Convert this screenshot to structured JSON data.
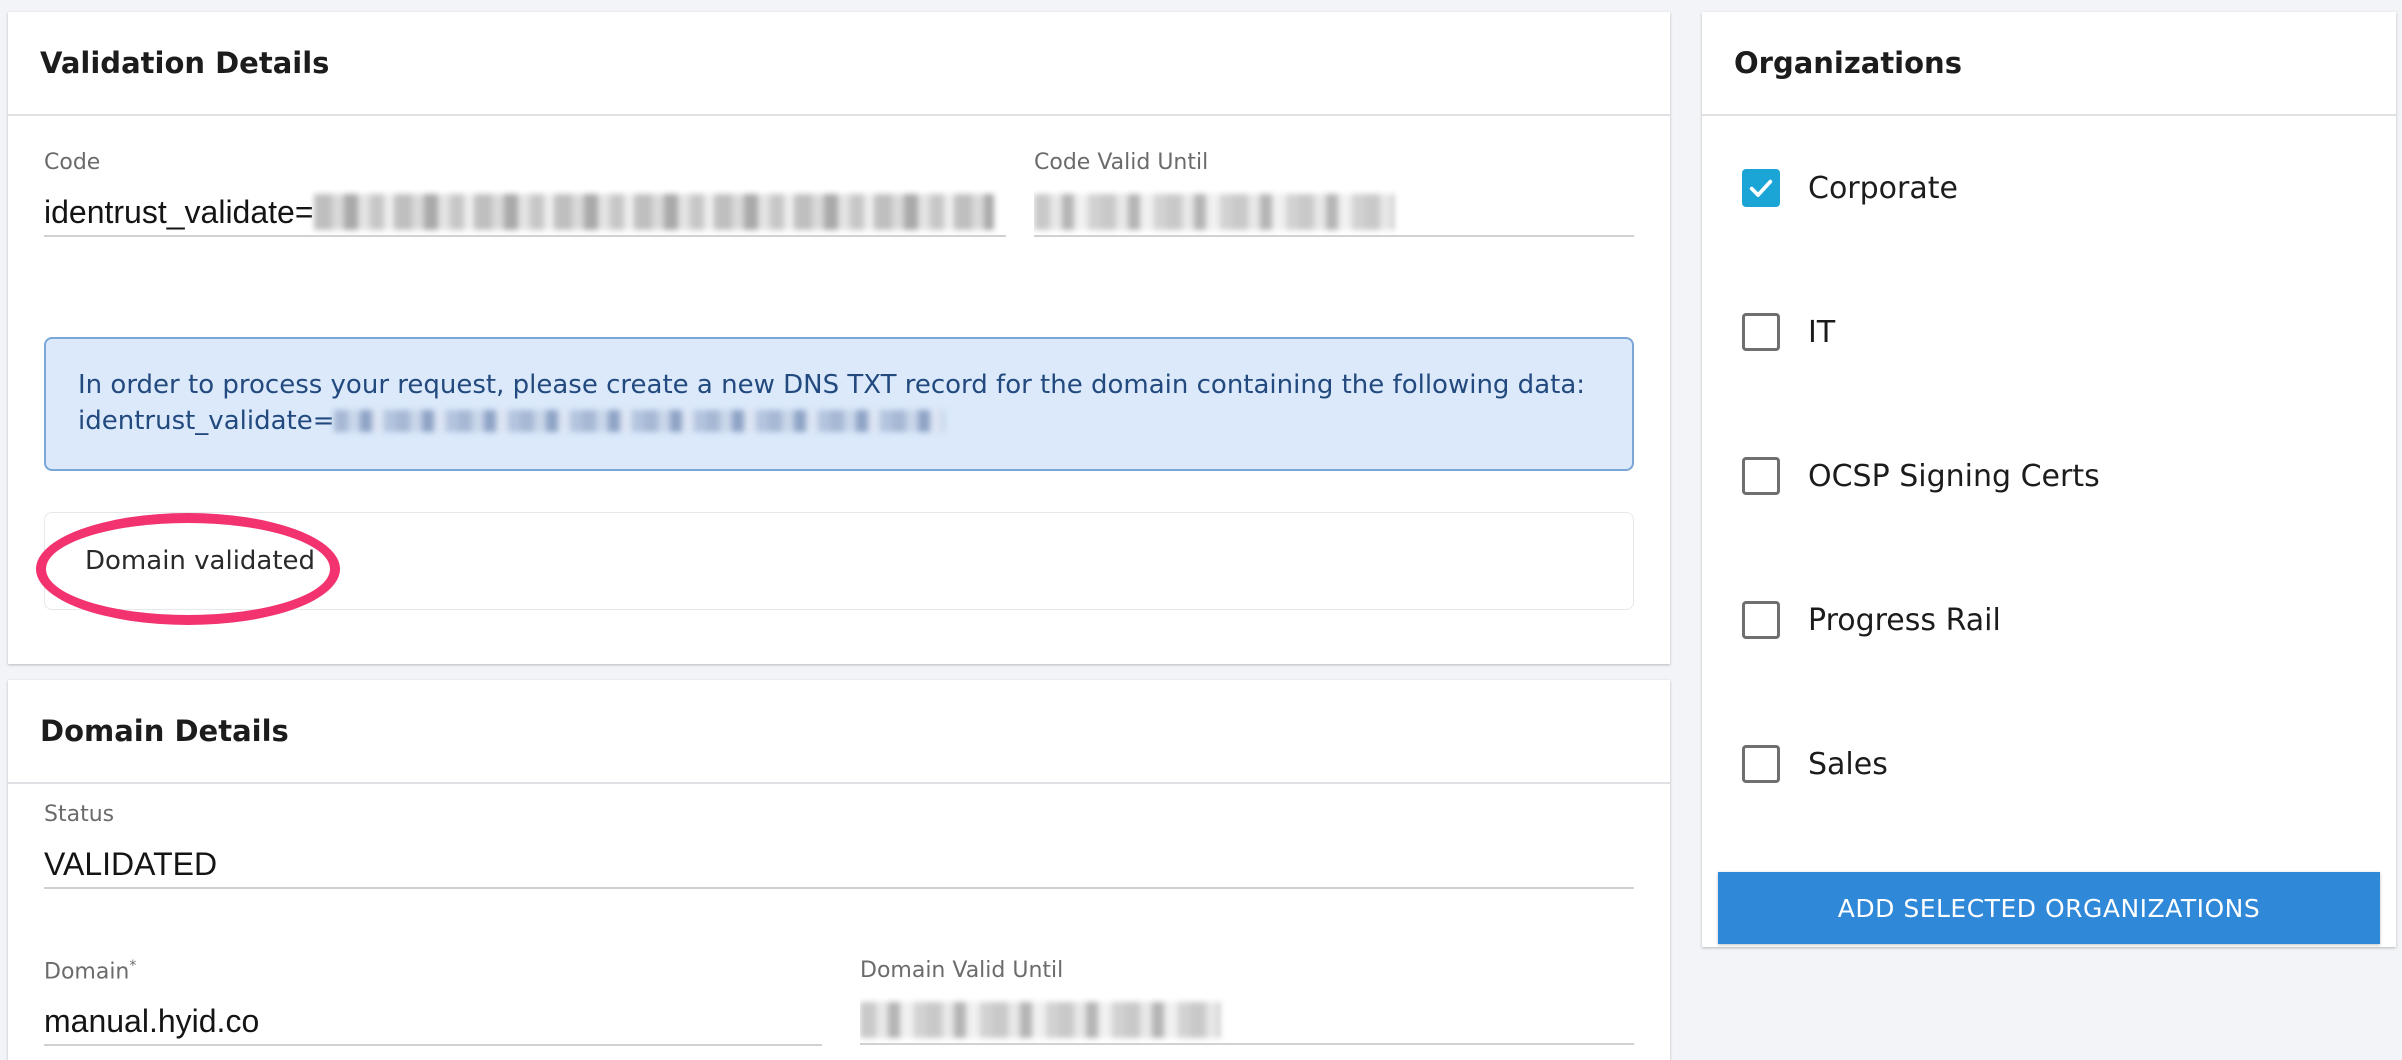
{
  "validation": {
    "title": "Validation Details",
    "code_label": "Code",
    "code_value": "identrust_validate=",
    "code_valid_until_label": "Code Valid Until",
    "info_line1": "In order to process your request, please create a new DNS TXT record for the domain containing the following data:",
    "info_line2": "identrust_validate=",
    "status_message": "Domain validated"
  },
  "domain": {
    "title": "Domain Details",
    "status_label": "Status",
    "status_value": "VALIDATED",
    "domain_label": "Domain",
    "domain_required_mark": "*",
    "domain_value": "manual.hyid.co",
    "domain_valid_until_label": "Domain Valid Until"
  },
  "organizations": {
    "title": "Organizations",
    "items": [
      {
        "label": "Corporate",
        "checked": true
      },
      {
        "label": "IT",
        "checked": false
      },
      {
        "label": "OCSP Signing Certs",
        "checked": false
      },
      {
        "label": "Progress Rail",
        "checked": false
      },
      {
        "label": "Sales",
        "checked": false
      }
    ],
    "add_button": "ADD SELECTED ORGANIZATIONS"
  },
  "colors": {
    "accent": "#2f88d8",
    "checkbox_checked": "#1aa5d6",
    "highlight": "#f2336f",
    "info_bg": "#dbe9fb"
  }
}
